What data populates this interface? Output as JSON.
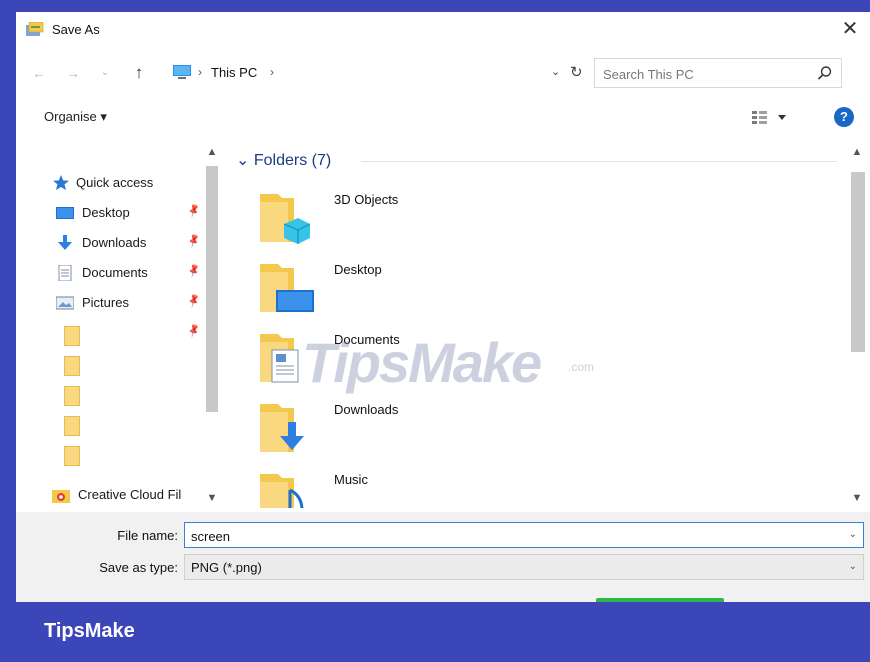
{
  "window": {
    "title": "Save As",
    "close_glyph": "✕"
  },
  "nav": {
    "back_glyph": "←",
    "forward_glyph": "→",
    "recent_glyph": "⌄",
    "up_glyph": "↑",
    "breadcrumb": [
      "This PC"
    ],
    "separator": "›",
    "dropdown_glyph": "⌄",
    "refresh_glyph": "↻",
    "search_placeholder": "Search This PC"
  },
  "toolbar": {
    "organise_label": "Organise ▾",
    "help_glyph": "?"
  },
  "sidebar": {
    "quick_access": "Quick access",
    "items": [
      {
        "label": "Desktop",
        "icon": "desktop-icon"
      },
      {
        "label": "Downloads",
        "icon": "downloads-icon"
      },
      {
        "label": "Documents",
        "icon": "documents-icon"
      },
      {
        "label": "Pictures",
        "icon": "pictures-icon"
      }
    ],
    "creative_cloud": "Creative Cloud Fil",
    "pin_glyph": "📌"
  },
  "content": {
    "group_header": "Folders (7)",
    "folders": [
      "3D Objects",
      "Desktop",
      "Documents",
      "Downloads",
      "Music"
    ]
  },
  "bottom": {
    "file_name_label": "File name:",
    "file_name_value": "screen",
    "save_as_type_label": "Save as type:",
    "save_as_type_value": "PNG (*.png)"
  },
  "watermark": {
    "text": "TipsMake",
    "suffix": ".com"
  },
  "brand": "TipsMake",
  "colors": {
    "background": "#3b47b8",
    "accent": "#1a67c4",
    "folder": "#f9d880"
  }
}
